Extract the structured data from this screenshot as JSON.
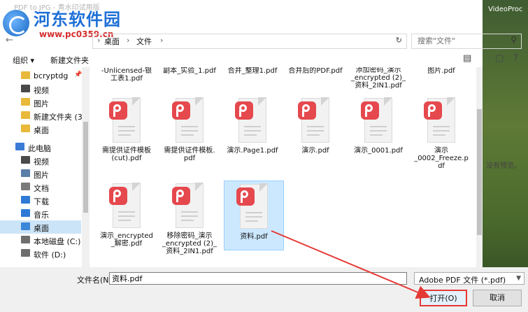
{
  "window": {
    "title": "PDF to JPG - 青水印试用版"
  },
  "watermark": {
    "site_name": "河东软件园",
    "url": "www.pc0359.cn"
  },
  "background": {
    "app_label": "VideoProc"
  },
  "breadcrumb": {
    "segments": [
      "桌面",
      "文件"
    ]
  },
  "search": {
    "placeholder": "搜索\"文件\""
  },
  "toolbar": {
    "organize_label": "组织 ▾",
    "new_folder_label": "新建文件夹"
  },
  "sidebar": {
    "items": [
      {
        "label": "bcryptdg",
        "icon": "folder-icon",
        "pinned": true
      },
      {
        "label": "视频",
        "icon": "video-icon"
      },
      {
        "label": "图片",
        "icon": "folder-icon"
      },
      {
        "label": "新建文件夹 (3)",
        "icon": "folder-icon"
      },
      {
        "label": "桌面",
        "icon": "folder-icon"
      },
      {
        "label": "此电脑",
        "icon": "computer-icon"
      },
      {
        "label": "视频",
        "icon": "video-icon"
      },
      {
        "label": "图片",
        "icon": "pictures-icon"
      },
      {
        "label": "文档",
        "icon": "documents-icon"
      },
      {
        "label": "下载",
        "icon": "download-icon"
      },
      {
        "label": "音乐",
        "icon": "music-icon"
      },
      {
        "label": "桌面",
        "icon": "desktop-icon",
        "selected": true
      },
      {
        "label": "本地磁盘 (C:)",
        "icon": "drive-icon"
      },
      {
        "label": "软件 (D:)",
        "icon": "drive-icon"
      }
    ]
  },
  "files": {
    "top_row_partial": [
      "-Unlicensed-银\n工表1.pdf",
      "副本_实验_1.pdf",
      "合并_整理1.pdf",
      "合并后的PDF.pdf",
      "添加密码_演示\n_encrypted (2)_\n资料_2IN1.pdf",
      "图片.pdf"
    ],
    "items": [
      {
        "label": "需提供证件模板\n(cut).pdf"
      },
      {
        "label": "需提供证件模板.\npdf"
      },
      {
        "label": "演示.Page1.pdf"
      },
      {
        "label": "演示.pdf"
      },
      {
        "label": "演示_0001.pdf"
      },
      {
        "label": "演示\n_0002_Freeze.p\ndf"
      },
      {
        "label": "演示_encrypted\n_解密.pdf"
      },
      {
        "label": "移除密码_演示\n_encrypted (2)_\n资料_2IN1.pdf"
      },
      {
        "label": "资料.pdf",
        "selected": true
      }
    ]
  },
  "preview": {
    "text": "没有预览。"
  },
  "footer": {
    "filename_label": "文件名(N):",
    "filename_value": "资料.pdf",
    "filetype_value": "Adobe PDF 文件 (*.pdf)",
    "open_label": "打开(O)",
    "cancel_label": "取消"
  },
  "colors": {
    "accent_selection": "#cce8ff",
    "pdf_badge": "#e5484d",
    "highlight_red": "#e53935"
  }
}
